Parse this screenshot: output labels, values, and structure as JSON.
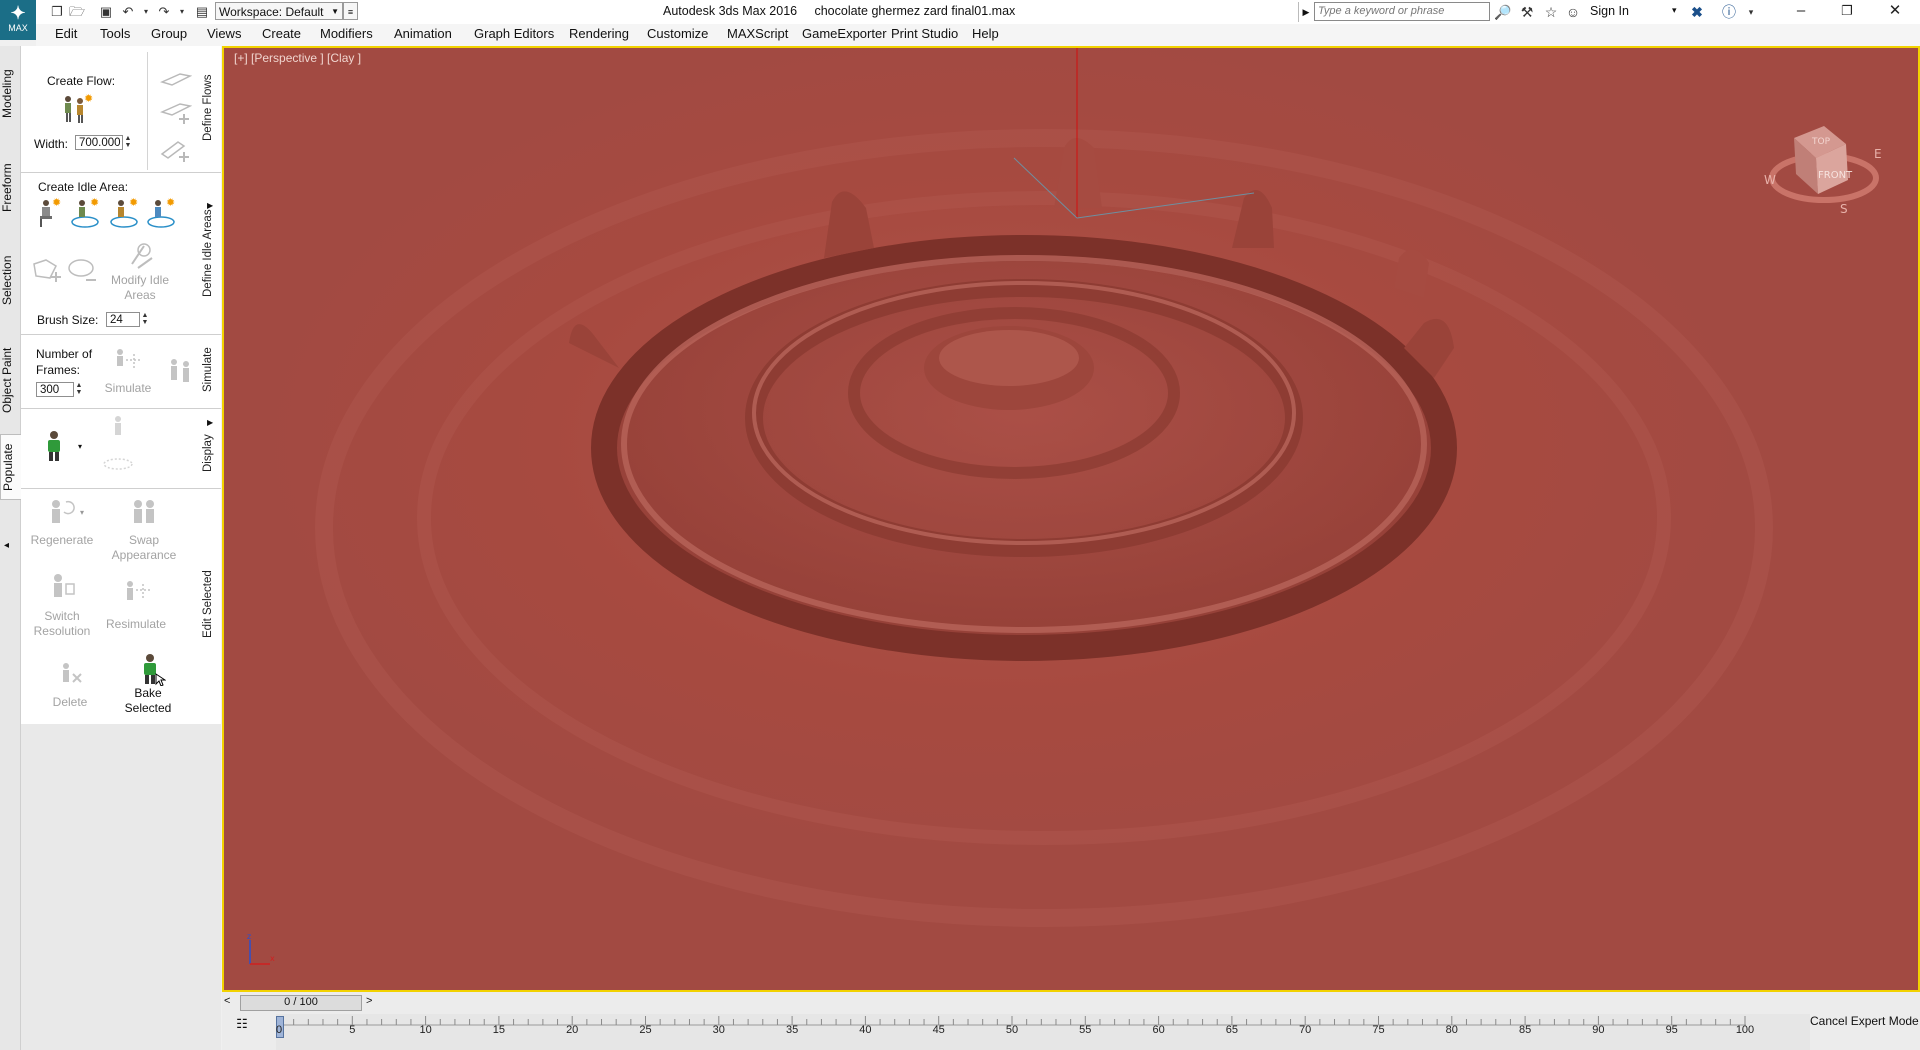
{
  "app": {
    "title": "Autodesk 3ds Max 2016     chocolate ghermez zard final01.max",
    "logo_label": "MAX",
    "workspace": "Workspace: Default",
    "search_placeholder": "Type a keyword or phrase",
    "sign_in": "Sign In"
  },
  "menu": [
    "Edit",
    "Tools",
    "Group",
    "Views",
    "Create",
    "Modifiers",
    "Animation",
    "Graph Editors",
    "Rendering",
    "Customize",
    "MAXScript",
    "GameExporter",
    "Print Studio",
    "Help"
  ],
  "left_tabs": [
    "Modeling",
    "Freeform",
    "Selection",
    "Object Paint",
    "Populate"
  ],
  "panel": {
    "create_flow": "Create Flow:",
    "width_label": "Width:",
    "width_value": "700.000",
    "create_idle_area": "Create Idle Area:",
    "modify_idle_areas": "Modify Idle Areas",
    "brush_size_label": "Brush Size:",
    "brush_size_value": "24",
    "number_of_frames": "Number of Frames:",
    "frames_value": "300",
    "simulate": "Simulate",
    "regenerate": "Regenerate",
    "swap_appearance": "Swap Appearance",
    "switch_resolution": "Switch Resolution",
    "resimulate": "Resimulate",
    "delete": "Delete",
    "bake_selected": "Bake Selected",
    "section_tabs": [
      "Define Flows",
      "Define Idle Areas",
      "Simulate",
      "Display",
      "Edit Selected"
    ]
  },
  "viewport": {
    "label": "[+] [Perspective ] [Clay ]",
    "viewcube_top": "TOP",
    "viewcube_front": "FRONT",
    "compass": [
      "W",
      "E",
      "S"
    ]
  },
  "timeline": {
    "slider": "0 / 100",
    "ticks": [
      "5",
      "10",
      "15",
      "20",
      "25",
      "30",
      "35",
      "40",
      "45",
      "50",
      "55",
      "60",
      "65",
      "70",
      "75",
      "80",
      "85",
      "90",
      "95",
      "100"
    ],
    "current": "0",
    "cancel_expert_mode": "Cancel Expert Mode"
  },
  "colors": {
    "viewport_bg": "#a74a40",
    "viewport_border": "#f2d200",
    "accent": "#1b6e87"
  }
}
